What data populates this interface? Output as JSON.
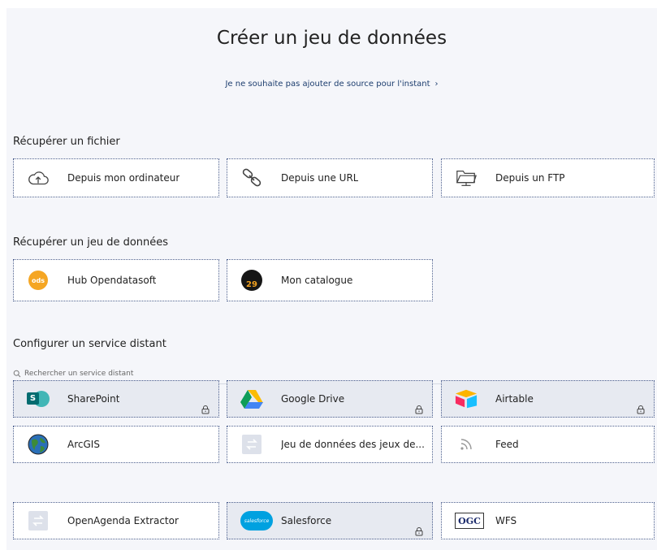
{
  "header": {
    "title": "Créer un jeu de données",
    "skip_link": "Je ne souhaite pas ajouter de source pour l'instant",
    "skip_chevron": "›"
  },
  "sections": {
    "file": "Récupérer un fichier",
    "dataset": "Récupérer un jeu de données",
    "remote": "Configurer un service distant"
  },
  "file_sources": [
    {
      "label": "Depuis mon ordinateur",
      "icon": "cloud-upload-icon"
    },
    {
      "label": "Depuis une URL",
      "icon": "link-icon"
    },
    {
      "label": "Depuis un FTP",
      "icon": "ftp-folder-icon"
    }
  ],
  "dataset_sources": [
    {
      "label": "Hub Opendatasoft",
      "icon": "ods-logo-icon",
      "icon_text": "ods"
    },
    {
      "label": "Mon catalogue",
      "icon": "catalogue-logo-icon",
      "icon_text": "29"
    }
  ],
  "search": {
    "placeholder": "Rechercher un service distant"
  },
  "services": [
    {
      "label": "SharePoint",
      "icon": "sharepoint-icon",
      "icon_text": "S",
      "locked": true
    },
    {
      "label": "Google Drive",
      "icon": "google-drive-icon",
      "locked": true
    },
    {
      "label": "Airtable",
      "icon": "airtable-icon",
      "locked": true
    },
    {
      "label": "ArcGIS",
      "icon": "arcgis-globe-icon",
      "locked": false
    },
    {
      "label": "Jeu de données des jeux de...",
      "icon": "exchange-arrows-icon",
      "locked": false
    },
    {
      "label": "Feed",
      "icon": "rss-feed-icon",
      "locked": false
    },
    {
      "label": "OpenAgenda Extractor",
      "icon": "exchange-arrows-icon",
      "locked": false
    },
    {
      "label": "Salesforce",
      "icon": "salesforce-icon",
      "icon_text": "salesforce",
      "locked": true
    },
    {
      "label": "WFS",
      "icon": "ogc-logo-icon",
      "icon_text": "OGC",
      "locked": false
    }
  ],
  "colors": {
    "background": "#f5f6fa",
    "card_border": "#4a5d8c",
    "locked_card": "#e7eaf1",
    "link": "#1c3d6e"
  }
}
